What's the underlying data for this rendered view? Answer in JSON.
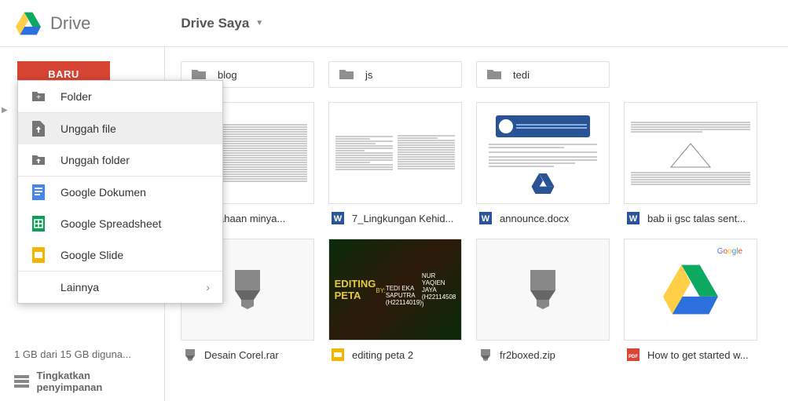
{
  "header": {
    "app": "Drive",
    "myDrive": "Drive Saya"
  },
  "sidebar": {
    "newBtn": "BARU",
    "storageText": "1 GB dari 15 GB diguna...",
    "upgradeText": "Tingkatkan penyimpanan"
  },
  "menu": {
    "folder": "Folder",
    "uploadFile": "Unggah file",
    "uploadFolder": "Unggah folder",
    "docs": "Google Dokumen",
    "sheets": "Google Spreadsheet",
    "slides": "Google Slide",
    "more": "Lainnya"
  },
  "folders": [
    {
      "name": "blog"
    },
    {
      "name": "js"
    },
    {
      "name": "tedi"
    }
  ],
  "files": {
    "f1": "rusahaan minya...",
    "f2": "7_Lingkungan Kehid...",
    "f3": "announce.docx",
    "f4": "bab ii gsc talas sent...",
    "f5": "Desain Corel.rar",
    "f6": "editing peta 2",
    "f7": "fr2boxed.zip",
    "f8": "How to get started w..."
  },
  "thumbs": {
    "editTitle": "EDITING PETA",
    "editBy": "BY:",
    "editAuth1": "TEDI EKA SAPUTRA (H22114019)",
    "editAuth2": "NUR YAQIEN JAYA (H22114508 )"
  }
}
